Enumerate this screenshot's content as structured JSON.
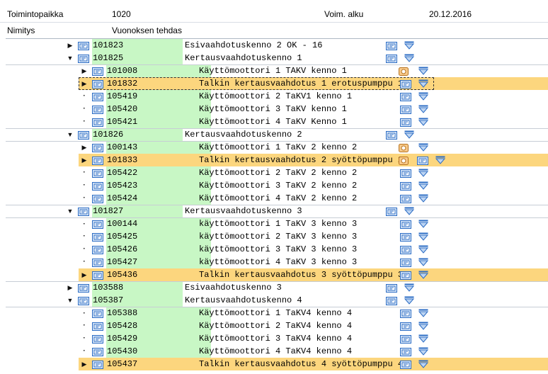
{
  "header": {
    "location_label": "Toimintopaikka",
    "location_value": "1020",
    "valid_from_label": "Voim. alku",
    "valid_from_value": "20.12.2016",
    "name_label": "Nimitys",
    "name_value": "Vuonoksen tehdas"
  },
  "tree": [
    {
      "level": 0,
      "toggle": "collapsed",
      "code": "101823",
      "desc": "Esivaahdotuskenno 2 OK - 16",
      "record": false,
      "highlight": false
    },
    {
      "level": 0,
      "toggle": "expanded",
      "code": "101825",
      "desc": "Kertausvaahdotuskenno 1",
      "record": false,
      "highlight": false
    },
    {
      "level": 1,
      "toggle": "collapsed",
      "code": "101008",
      "desc": "Käyttömoottori 1 TAKV kenno 1",
      "record": true,
      "highlight": false,
      "sep": true
    },
    {
      "level": 1,
      "toggle": "collapsed",
      "code": "101832",
      "desc": "Talkin kertausvaahdotus 1 erotuspumppu 1",
      "record": false,
      "highlight": true,
      "selected": true
    },
    {
      "level": 1,
      "toggle": "leaf",
      "code": "105419",
      "desc": "Käyttömoottori 2 TaKV1 kenno 1",
      "record": false,
      "highlight": false
    },
    {
      "level": 1,
      "toggle": "leaf",
      "code": "105420",
      "desc": "Käyttömoottori 3 TaKV kenno 1",
      "record": false,
      "highlight": false
    },
    {
      "level": 1,
      "toggle": "leaf",
      "code": "105421",
      "desc": "Käyttömoottori 4 TaKV Kenno 1",
      "record": false,
      "highlight": false
    },
    {
      "level": 0,
      "toggle": "expanded",
      "code": "101826",
      "desc": "Kertausvaahdotuskenno 2",
      "record": false,
      "highlight": false,
      "sep": true
    },
    {
      "level": 1,
      "toggle": "collapsed",
      "code": "100143",
      "desc": "Käyttömoottori 1 TaKv 2 kenno 2",
      "record": true,
      "highlight": false,
      "sep": true
    },
    {
      "level": 1,
      "toggle": "collapsed",
      "code": "101833",
      "desc": "Talkin kertausvaahdotus 2 syöttöpumppu 2",
      "record": true,
      "highlight": true
    },
    {
      "level": 1,
      "toggle": "leaf",
      "code": "105422",
      "desc": "Käyttömoottori 2 TaKV 2 kenno 2",
      "record": false,
      "highlight": false
    },
    {
      "level": 1,
      "toggle": "leaf",
      "code": "105423",
      "desc": "Käyttömoottori 3 TaKV 2 kenno 2",
      "record": false,
      "highlight": false
    },
    {
      "level": 1,
      "toggle": "leaf",
      "code": "105424",
      "desc": "Käyttömoottori 4 TaKV 2 kenno 2",
      "record": false,
      "highlight": false
    },
    {
      "level": 0,
      "toggle": "expanded",
      "code": "101827",
      "desc": "Kertausvaahdotuskenno 3",
      "record": false,
      "highlight": false,
      "sep": true
    },
    {
      "level": 1,
      "toggle": "leaf",
      "code": "100144",
      "desc": "käyttömoottori 1 TaKV 3 kenno 3",
      "record": false,
      "highlight": false,
      "sep": true
    },
    {
      "level": 1,
      "toggle": "leaf",
      "code": "105425",
      "desc": "käyttömoottori 2 TaKV 3 kenno 3",
      "record": false,
      "highlight": false
    },
    {
      "level": 1,
      "toggle": "leaf",
      "code": "105426",
      "desc": "käyttömoottori 3 TaKV 3 kenno 3",
      "record": false,
      "highlight": false
    },
    {
      "level": 1,
      "toggle": "leaf",
      "code": "105427",
      "desc": "käyttömoottori 4 TaKV 3 kenno 3",
      "record": false,
      "highlight": false
    },
    {
      "level": 1,
      "toggle": "collapsed",
      "code": "105436",
      "desc": "Talkin kertausvaahdotus 3 syöttöpumppu 3",
      "record": false,
      "highlight": true
    },
    {
      "level": 0,
      "toggle": "collapsed",
      "code": "103588",
      "desc": "Esivaahdotuskenno 3",
      "record": false,
      "highlight": false,
      "sep": true
    },
    {
      "level": 0,
      "toggle": "expanded",
      "code": "105387",
      "desc": "Kertausvaahdotuskenno 4",
      "record": false,
      "highlight": false
    },
    {
      "level": 1,
      "toggle": "leaf",
      "code": "105388",
      "desc": "Käyttömoottori 1 TaKV4 kenno 4",
      "record": false,
      "highlight": false,
      "sep": true
    },
    {
      "level": 1,
      "toggle": "leaf",
      "code": "105428",
      "desc": "Käyttömoottori 2 TaKV4 kenno 4",
      "record": false,
      "highlight": false
    },
    {
      "level": 1,
      "toggle": "leaf",
      "code": "105429",
      "desc": "Käyttömoottori 3 TaKV4 kenno 4",
      "record": false,
      "highlight": false
    },
    {
      "level": 1,
      "toggle": "leaf",
      "code": "105430",
      "desc": "Käyttömoottori 4 TaKV4 kenno 4",
      "record": false,
      "highlight": false
    },
    {
      "level": 1,
      "toggle": "collapsed",
      "code": "105437",
      "desc": "Talkin kertausvaahdotus 4 syöttöpumppu 4",
      "record": false,
      "highlight": true
    }
  ],
  "icons": {
    "object": "equipment-object-icon",
    "menu": "dropdown-menu-icon",
    "record": "measurement-record-icon"
  },
  "colors": {
    "green_band": "#c8f7c5",
    "highlight": "#fcd67e",
    "icon_blue": "#2b6cc4"
  }
}
